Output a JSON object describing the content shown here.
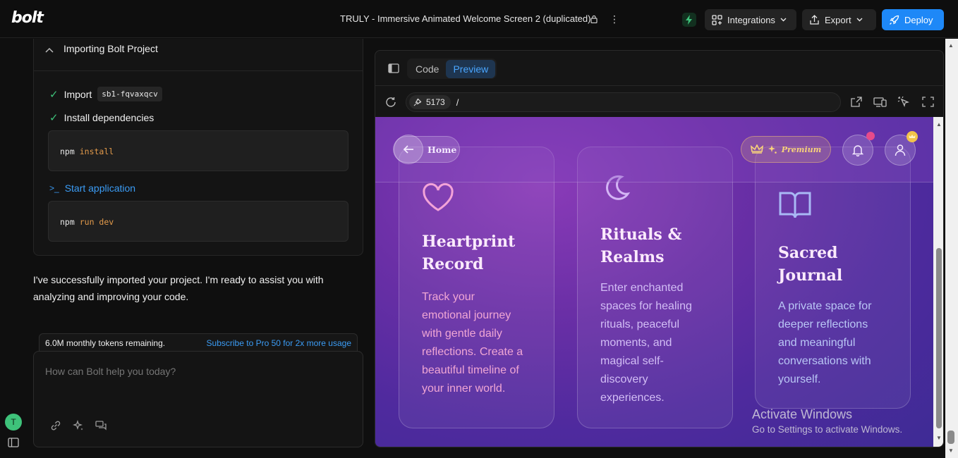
{
  "header": {
    "logo": "bolt",
    "project_title": "TRULY - Immersive Animated Welcome Screen 2 (duplicated)",
    "more_icon": "⋮",
    "integrations_label": "Integrations",
    "export_label": "Export",
    "deploy_label": "Deploy"
  },
  "chat": {
    "import_card": {
      "title": "Importing Bolt Project",
      "step_import_label": "Import",
      "step_import_code": "sb1-fqvaxqcv",
      "step_install_label": "Install dependencies",
      "install_cmd": "npm",
      "install_arg": "install",
      "start_label": "Start application",
      "start_prompt": ">_",
      "run_cmd": "npm",
      "run_arg": "run dev"
    },
    "assistant_message": "I've successfully imported your project. I'm ready to assist you with analyzing and improving your code.",
    "tokens_remaining": "6.0M monthly tokens remaining.",
    "subscribe_link": "Subscribe to Pro 50 for 2x more usage",
    "prompt_placeholder": "How can Bolt help you today?",
    "avatar_initial": "T"
  },
  "preview": {
    "tabs": [
      {
        "label": "Code",
        "active": false
      },
      {
        "label": "Preview",
        "active": true
      }
    ],
    "port": "5173",
    "path": "/",
    "app": {
      "home_label": "Home",
      "premium_label": "Premium",
      "cards": [
        {
          "title_line1": "Heartprint",
          "title_line2": "Record",
          "icon": "heart-icon",
          "desc_lines": [
            "Track your",
            "emotional journey",
            "with gentle daily",
            "reflections. Create a",
            "beautiful timeline of",
            "your inner world."
          ]
        },
        {
          "title_line1": "Rituals &",
          "title_line2": "Realms",
          "icon": "moon-icon",
          "desc_lines": [
            "Enter enchanted",
            "spaces for healing",
            "rituals, peaceful",
            "moments, and",
            "magical self-",
            "discovery",
            "experiences."
          ]
        },
        {
          "title_line1": "Sacred",
          "title_line2": "Journal",
          "icon": "book-icon",
          "desc_lines": [
            "A private space for",
            "deeper reflections",
            "and meaningful",
            "conversations with",
            "yourself."
          ]
        }
      ]
    },
    "watermark_line1": "Activate Windows",
    "watermark_line2": "Go to Settings to activate Windows."
  },
  "colors": {
    "accent_blue": "#1e88f7",
    "success_green": "#3ec27a",
    "link_blue": "#3b9cf5",
    "cmd_orange": "#e39a4a"
  }
}
